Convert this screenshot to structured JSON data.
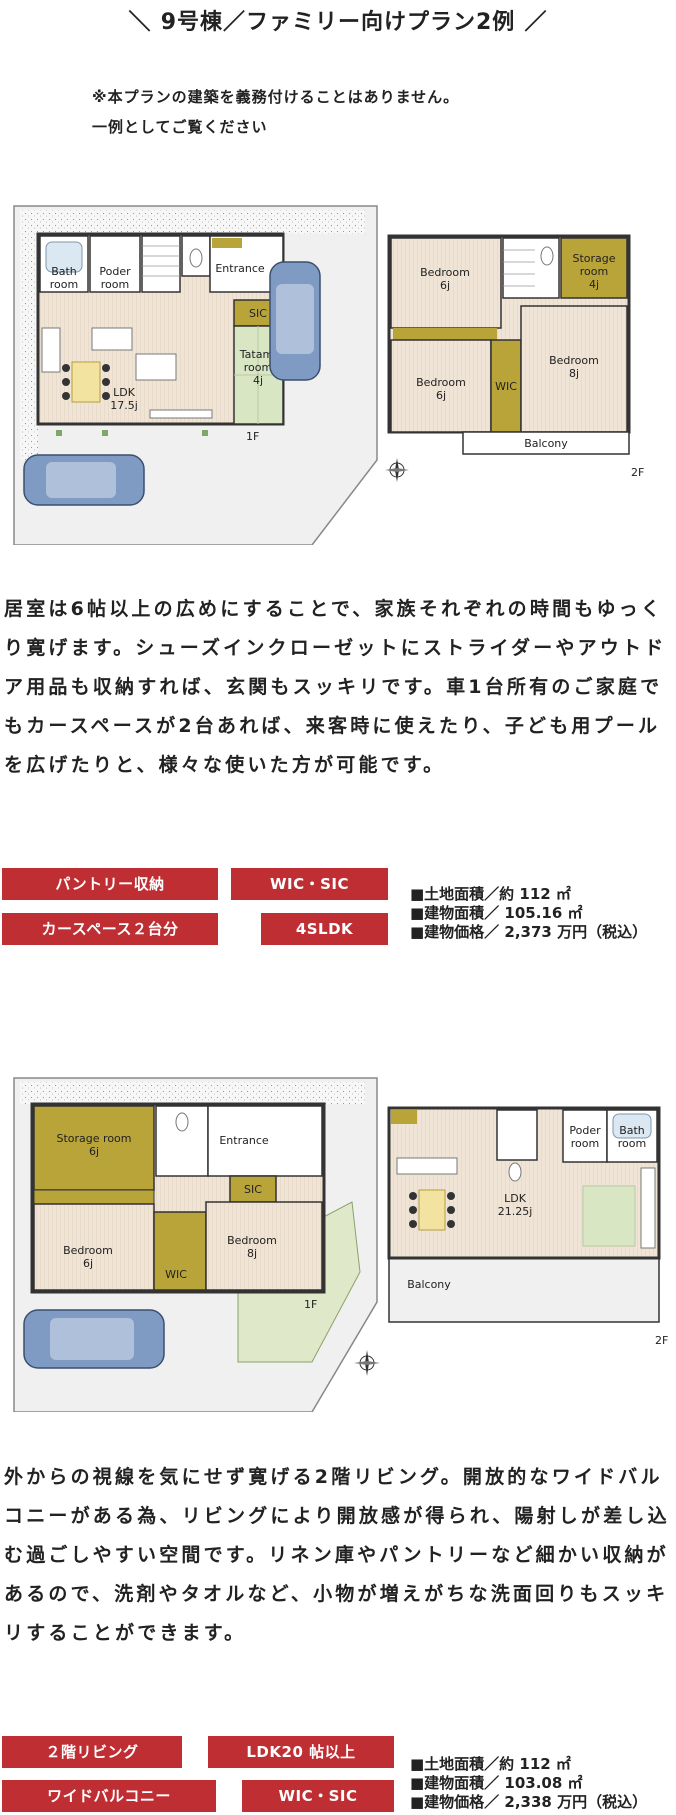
{
  "header": {
    "title": "9号棟／ファミリー向けプラン2例",
    "slash_left": "＼",
    "slash_right": "／"
  },
  "notice": {
    "line1": "※本プランの建築を義務付けることはありません。",
    "line2": "一例としてご覧ください"
  },
  "plan1": {
    "floor1": {
      "rooms": {
        "bath": "Bath\nroom",
        "bath_l1": "Bath",
        "bath_l2": "room",
        "poder_l1": "Poder",
        "poder_l2": "room",
        "entrance": "Entrance",
        "sic": "SIC",
        "tatami_l1": "Tatami",
        "tatami_l2": "room",
        "tatami_l3": "4j",
        "ldk_l1": "LDK",
        "ldk_l2": "17.5j"
      },
      "floor_label": "1F"
    },
    "floor2": {
      "rooms": {
        "bed1_l1": "Bedroom",
        "bed1_l2": "6j",
        "storage_l1": "Storage",
        "storage_l2": "room",
        "storage_l3": "4j",
        "bed2_l1": "Bedroom",
        "bed2_l2": "6j",
        "wic": "WIC",
        "bed3_l1": "Bedroom",
        "bed3_l2": "8j",
        "balcony": "Balcony"
      },
      "floor_label": "2F"
    },
    "compass_label": "N",
    "description": "居室は6帖以上の広めにすることで、家族それぞれの時間もゆっくり寛げます。シューズインクローゼットにストライダーやアウトドア用品も収納すれば、玄関もスッキリです。車1台所有のご家庭でもカースペースが2台あれば、来客時に使えたり、子ども用プールを広げたりと、様々な使いた方が可能です。",
    "tags": [
      "パントリー収納",
      "WIC・SIC",
      "カースペース２台分",
      "4SLDK"
    ],
    "specs": {
      "land": "■土地面積／約 112 ㎡",
      "building": "■建物面積／ 105.16 ㎡",
      "price": "■建物価格／ 2,373 万円（税込）"
    }
  },
  "plan2": {
    "floor1": {
      "rooms": {
        "storage_l1": "Storage room",
        "storage_l2": "6j",
        "entrance": "Entrance",
        "sic": "SIC",
        "bed1_l1": "Bedroom",
        "bed1_l2": "6j",
        "wic": "WIC",
        "bed2_l1": "Bedroom",
        "bed2_l2": "8j"
      },
      "floor_label": "1F"
    },
    "floor2": {
      "rooms": {
        "poder_l1": "Poder",
        "poder_l2": "room",
        "bath_l1": "Bath",
        "bath_l2": "room",
        "ldk_l1": "LDK",
        "ldk_l2": "21.25j",
        "balcony": "Balcony"
      },
      "floor_label": "2F"
    },
    "compass_label": "N",
    "description": "外からの視線を気にせず寛げる2階リビング。開放的なワイドバルコニーがある為、リビングにより開放感が得られ、陽射しが差し込む過ごしやすい空間です。リネン庫やパントリーなど細かい収納があるので、洗剤やタオルなど、小物が増えがちな洗面回りもスッキリすることができます。",
    "tags": [
      "２階リビング",
      "LDK20 帖以上",
      "ワイドバルコニー",
      "WIC・SIC"
    ],
    "specs": {
      "land": "■土地面積／約 112 ㎡",
      "building": "■建物面積／ 103.08 ㎡",
      "price": "■建物価格／ 2,338 万円（税込）"
    }
  },
  "colors": {
    "accent_red": "#bf2e33",
    "storage_olive": "#b9a43a",
    "floor_wood": "#efe4d6",
    "tatami_green": "#d9e6c4",
    "car_blue": "#7f9bc4",
    "garden_green": "#dfe8c8",
    "ground_gray": "#f0f0f0"
  }
}
